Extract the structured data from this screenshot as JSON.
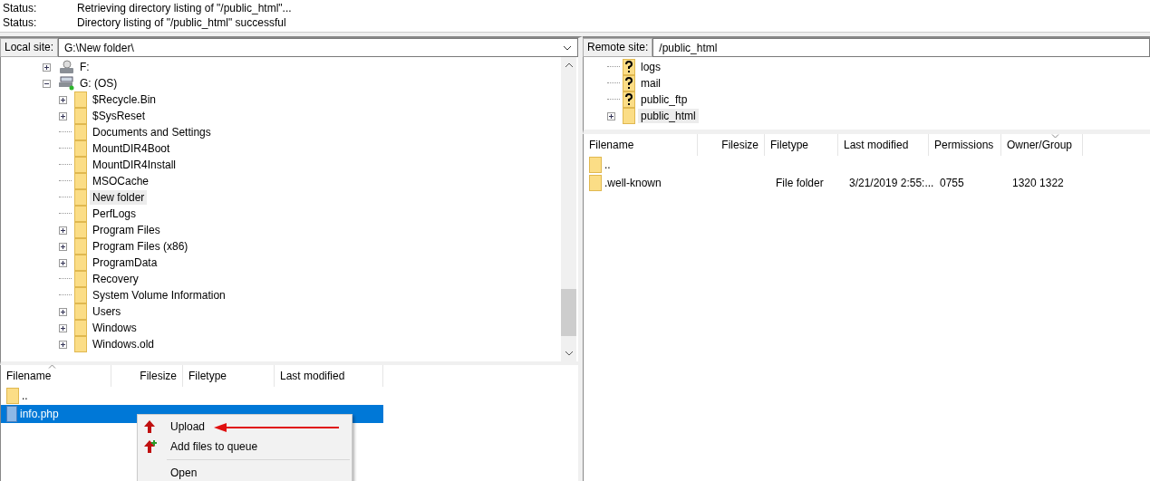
{
  "message_log": [
    {
      "label": "Status:",
      "text": "Retrieving directory listing of \"/public_html\"..."
    },
    {
      "label": "Status:",
      "text": "Directory listing of \"/public_html\" successful"
    }
  ],
  "local": {
    "site_label": "Local site:",
    "path": "G:\\New folder\\",
    "tree": [
      {
        "name": "F:",
        "kind": "drive",
        "expanded": false,
        "selected": false
      },
      {
        "name": "G: (OS)",
        "kind": "system-drive",
        "expanded": true,
        "selected": false,
        "children": [
          {
            "name": "$Recycle.Bin",
            "kind": "folder",
            "expanded": false,
            "selected": false
          },
          {
            "name": "$SysReset",
            "kind": "folder",
            "expanded": false,
            "selected": false
          },
          {
            "name": "Documents and Settings",
            "kind": "folder",
            "selected": false
          },
          {
            "name": "MountDIR4Boot",
            "kind": "folder",
            "selected": false
          },
          {
            "name": "MountDIR4Install",
            "kind": "folder",
            "selected": false
          },
          {
            "name": "MSOCache",
            "kind": "folder",
            "selected": false
          },
          {
            "name": "New folder",
            "kind": "folder",
            "selected": true
          },
          {
            "name": "PerfLogs",
            "kind": "folder",
            "selected": false
          },
          {
            "name": "Program Files",
            "kind": "folder",
            "expanded": false,
            "selected": false
          },
          {
            "name": "Program Files (x86)",
            "kind": "folder",
            "expanded": false,
            "selected": false
          },
          {
            "name": "ProgramData",
            "kind": "folder",
            "expanded": false,
            "selected": false
          },
          {
            "name": "Recovery",
            "kind": "folder",
            "selected": false
          },
          {
            "name": "System Volume Information",
            "kind": "folder",
            "selected": false
          },
          {
            "name": "Users",
            "kind": "folder",
            "expanded": false,
            "selected": false
          },
          {
            "name": "Windows",
            "kind": "folder",
            "expanded": false,
            "selected": false
          },
          {
            "name": "Windows.old",
            "kind": "folder",
            "expanded": false,
            "selected": false
          }
        ]
      }
    ],
    "columns": [
      {
        "label": "Filename",
        "sorted": true
      },
      {
        "label": "Filesize",
        "sorted": false
      },
      {
        "label": "Filetype",
        "sorted": false
      },
      {
        "label": "Last modified",
        "sorted": false
      }
    ],
    "files": [
      {
        "kind": "folder",
        "name": "..",
        "selected": false
      },
      {
        "kind": "file",
        "name": "info.php",
        "selected": true
      }
    ]
  },
  "remote": {
    "site_label": "Remote site:",
    "path": "/public_html",
    "tree": [
      {
        "name": "logs",
        "kind": "unknown",
        "selected": false
      },
      {
        "name": "mail",
        "kind": "unknown",
        "selected": false
      },
      {
        "name": "public_ftp",
        "kind": "unknown",
        "selected": false
      },
      {
        "name": "public_html",
        "kind": "folder",
        "expanded": false,
        "selected": true
      }
    ],
    "columns": [
      {
        "label": "Filename",
        "sorted": false
      },
      {
        "label": "Filesize",
        "sorted": false
      },
      {
        "label": "Filetype",
        "sorted": false
      },
      {
        "label": "Last modified",
        "sorted": false
      },
      {
        "label": "Permissions",
        "sorted": false
      },
      {
        "label": "Owner/Group",
        "sorted": true
      }
    ],
    "files": [
      {
        "kind": "folder",
        "name": "..",
        "selected": false
      },
      {
        "kind": "folder",
        "name": ".well-known",
        "selected": false,
        "cells": [
          "",
          "File folder",
          "3/21/2019 2:55:...",
          "0755",
          "1320 1322"
        ]
      }
    ]
  },
  "context_menu": [
    {
      "kind": "upload",
      "label": "Upload"
    },
    {
      "kind": "queue",
      "label": "Add files to queue"
    },
    {
      "kind": "separator"
    },
    {
      "kind": "plain",
      "label": "Open"
    }
  ]
}
